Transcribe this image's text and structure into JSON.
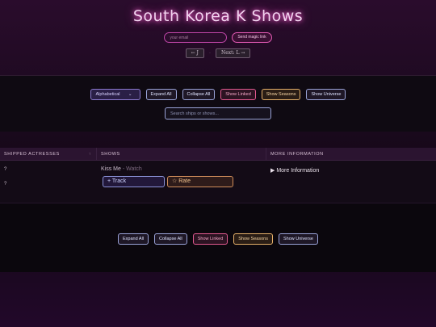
{
  "header": {
    "title": "South Korea K Shows",
    "email_placeholder": "your email",
    "magic_link_label": "Send magic link",
    "prev_label": "← J",
    "pager_separator": "·",
    "next_label": "Next: L →"
  },
  "controls": {
    "sort_select": "Alphabetical",
    "expand_all": "Expand All",
    "collapse_all": "Collapse All",
    "show_linked": "Show Linked",
    "show_seasons": "Show Seasons",
    "show_universe": "Show Universe",
    "search_placeholder": "Search ships or shows..."
  },
  "table": {
    "headers": [
      "SHIPPED ACTRESSES",
      "SHOWS",
      "MORE INFORMATION"
    ],
    "sort_indicator": "↑",
    "rows": [
      {
        "actresses": [
          "?",
          "?"
        ],
        "show_title": "Kiss Me",
        "show_sep": " - ",
        "watch_label": "Watch",
        "track_label": "+ Track",
        "rate_label": "☆ Rate",
        "more_info": "▶ More Information"
      }
    ]
  },
  "footer_controls": {
    "expand_all": "Expand All",
    "collapse_all": "Collapse All",
    "show_linked": "Show Linked",
    "show_seasons": "Show Seasons",
    "show_universe": "Show Universe"
  },
  "colors": {
    "title_glow": "#ff5fd2",
    "linked": "#e25a90",
    "seasons": "#e5b06a",
    "default_button": "#9aa3d8"
  }
}
